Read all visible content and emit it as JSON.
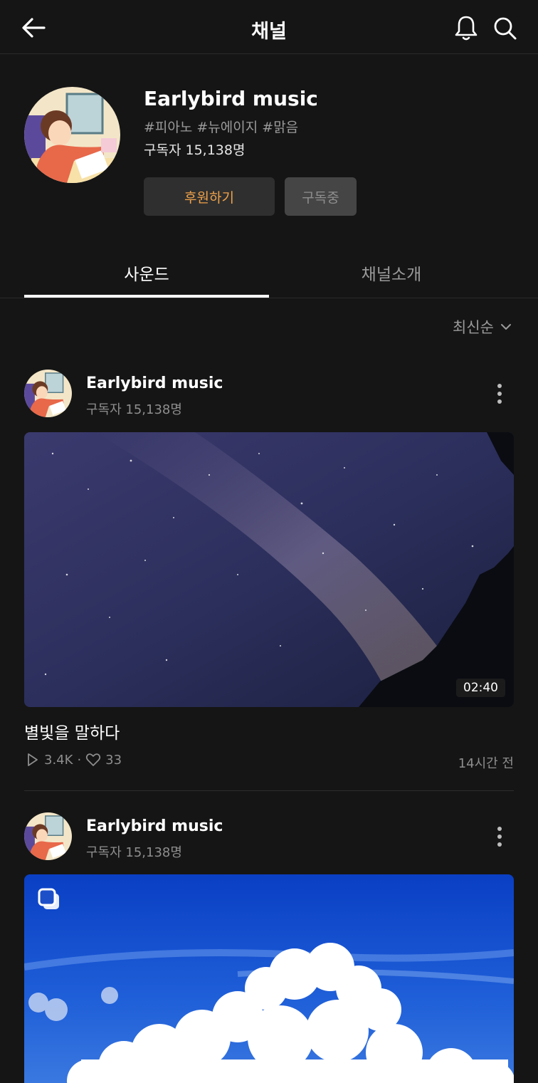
{
  "header": {
    "title": "채널"
  },
  "channel": {
    "name": "Earlybird music",
    "tags": "#피아노 #뉴에이지 #맑음",
    "subscribers": "구독자 15,138명",
    "support_label": "후원하기",
    "subscribe_label": "구독중"
  },
  "tabs": [
    {
      "label": "사운드",
      "active": true
    },
    {
      "label": "채널소개",
      "active": false
    }
  ],
  "sort": {
    "label": "최신순"
  },
  "posts": [
    {
      "author": "Earlybird music",
      "subscribers": "구독자 15,138명",
      "duration": "02:40",
      "title": "별빛을 말하다",
      "plays": "3.4K",
      "likes": "33",
      "time": "14시간 전"
    },
    {
      "author": "Earlybird music",
      "subscribers": "구독자 15,138명"
    }
  ],
  "colors": {
    "background": "#151515",
    "accent": "#f0a24a",
    "muted": "#8e8e8e"
  },
  "icons": [
    "back-arrow-icon",
    "bell-icon",
    "search-icon",
    "chevron-down-icon",
    "more-vertical-icon",
    "play-icon",
    "heart-icon",
    "multi-image-icon"
  ]
}
